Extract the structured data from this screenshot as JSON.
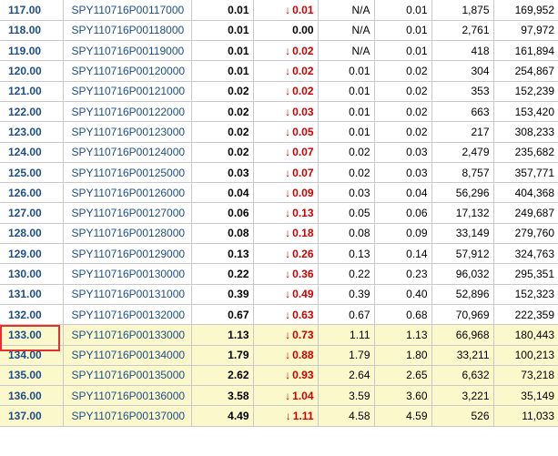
{
  "accent_colors": {
    "link": "#1d4e89",
    "down": "#cc0000",
    "itm_row_bg": "#fbf8cc",
    "highlight_border": "#e03232"
  },
  "down_icon": "down-arrow-icon",
  "rows": [
    {
      "strike": "117.00",
      "symbol": "SPY110716P00117000",
      "last": "0.01",
      "chg": "0.01",
      "chg_dir": "down",
      "bid": "N/A",
      "ask": "0.01",
      "vol": "1,875",
      "oi": "169,952",
      "itm": false
    },
    {
      "strike": "118.00",
      "symbol": "SPY110716P00118000",
      "last": "0.01",
      "chg": "0.00",
      "chg_dir": "none",
      "bid": "N/A",
      "ask": "0.01",
      "vol": "2,761",
      "oi": "97,972",
      "itm": false
    },
    {
      "strike": "119.00",
      "symbol": "SPY110716P00119000",
      "last": "0.01",
      "chg": "0.02",
      "chg_dir": "down",
      "bid": "N/A",
      "ask": "0.01",
      "vol": "418",
      "oi": "161,894",
      "itm": false
    },
    {
      "strike": "120.00",
      "symbol": "SPY110716P00120000",
      "last": "0.01",
      "chg": "0.02",
      "chg_dir": "down",
      "bid": "0.01",
      "ask": "0.02",
      "vol": "304",
      "oi": "254,867",
      "itm": false
    },
    {
      "strike": "121.00",
      "symbol": "SPY110716P00121000",
      "last": "0.02",
      "chg": "0.02",
      "chg_dir": "down",
      "bid": "0.01",
      "ask": "0.02",
      "vol": "353",
      "oi": "152,239",
      "itm": false
    },
    {
      "strike": "122.00",
      "symbol": "SPY110716P00122000",
      "last": "0.02",
      "chg": "0.03",
      "chg_dir": "down",
      "bid": "0.01",
      "ask": "0.02",
      "vol": "663",
      "oi": "153,420",
      "itm": false
    },
    {
      "strike": "123.00",
      "symbol": "SPY110716P00123000",
      "last": "0.02",
      "chg": "0.05",
      "chg_dir": "down",
      "bid": "0.01",
      "ask": "0.02",
      "vol": "217",
      "oi": "308,233",
      "itm": false
    },
    {
      "strike": "124.00",
      "symbol": "SPY110716P00124000",
      "last": "0.02",
      "chg": "0.07",
      "chg_dir": "down",
      "bid": "0.02",
      "ask": "0.03",
      "vol": "2,479",
      "oi": "235,682",
      "itm": false
    },
    {
      "strike": "125.00",
      "symbol": "SPY110716P00125000",
      "last": "0.03",
      "chg": "0.07",
      "chg_dir": "down",
      "bid": "0.02",
      "ask": "0.03",
      "vol": "8,757",
      "oi": "357,771",
      "itm": false
    },
    {
      "strike": "126.00",
      "symbol": "SPY110716P00126000",
      "last": "0.04",
      "chg": "0.09",
      "chg_dir": "down",
      "bid": "0.03",
      "ask": "0.04",
      "vol": "56,296",
      "oi": "404,368",
      "itm": false
    },
    {
      "strike": "127.00",
      "symbol": "SPY110716P00127000",
      "last": "0.06",
      "chg": "0.13",
      "chg_dir": "down",
      "bid": "0.05",
      "ask": "0.06",
      "vol": "17,132",
      "oi": "249,687",
      "itm": false
    },
    {
      "strike": "128.00",
      "symbol": "SPY110716P00128000",
      "last": "0.08",
      "chg": "0.18",
      "chg_dir": "down",
      "bid": "0.08",
      "ask": "0.09",
      "vol": "33,149",
      "oi": "279,760",
      "itm": false
    },
    {
      "strike": "129.00",
      "symbol": "SPY110716P00129000",
      "last": "0.13",
      "chg": "0.26",
      "chg_dir": "down",
      "bid": "0.13",
      "ask": "0.14",
      "vol": "57,912",
      "oi": "324,763",
      "itm": false
    },
    {
      "strike": "130.00",
      "symbol": "SPY110716P00130000",
      "last": "0.22",
      "chg": "0.36",
      "chg_dir": "down",
      "bid": "0.22",
      "ask": "0.23",
      "vol": "96,032",
      "oi": "295,351",
      "itm": false
    },
    {
      "strike": "131.00",
      "symbol": "SPY110716P00131000",
      "last": "0.39",
      "chg": "0.49",
      "chg_dir": "down",
      "bid": "0.39",
      "ask": "0.40",
      "vol": "52,896",
      "oi": "152,323",
      "itm": false
    },
    {
      "strike": "132.00",
      "symbol": "SPY110716P00132000",
      "last": "0.67",
      "chg": "0.63",
      "chg_dir": "down",
      "bid": "0.67",
      "ask": "0.68",
      "vol": "70,969",
      "oi": "222,359",
      "itm": false,
      "highlighted": true
    },
    {
      "strike": "133.00",
      "symbol": "SPY110716P00133000",
      "last": "1.13",
      "chg": "0.73",
      "chg_dir": "down",
      "bid": "1.11",
      "ask": "1.13",
      "vol": "66,968",
      "oi": "180,443",
      "itm": true
    },
    {
      "strike": "134.00",
      "symbol": "SPY110716P00134000",
      "last": "1.79",
      "chg": "0.88",
      "chg_dir": "down",
      "bid": "1.79",
      "ask": "1.80",
      "vol": "33,211",
      "oi": "100,213",
      "itm": true
    },
    {
      "strike": "135.00",
      "symbol": "SPY110716P00135000",
      "last": "2.62",
      "chg": "0.93",
      "chg_dir": "down",
      "bid": "2.64",
      "ask": "2.65",
      "vol": "6,632",
      "oi": "73,218",
      "itm": true
    },
    {
      "strike": "136.00",
      "symbol": "SPY110716P00136000",
      "last": "3.58",
      "chg": "1.04",
      "chg_dir": "down",
      "bid": "3.59",
      "ask": "3.60",
      "vol": "3,221",
      "oi": "35,149",
      "itm": true
    },
    {
      "strike": "137.00",
      "symbol": "SPY110716P00137000",
      "last": "4.49",
      "chg": "1.11",
      "chg_dir": "down",
      "bid": "4.58",
      "ask": "4.59",
      "vol": "526",
      "oi": "11,033",
      "itm": true
    }
  ]
}
